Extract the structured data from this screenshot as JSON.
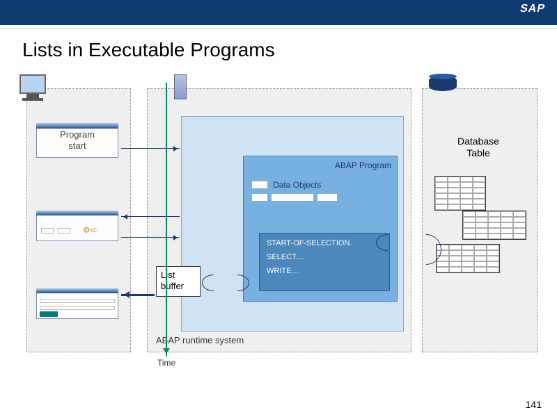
{
  "header": {
    "logo": "SAP"
  },
  "title": "Lists in Executable Programs",
  "left": {
    "program_start": "Program\nstart"
  },
  "center": {
    "runtime_label": "ABAP runtime system",
    "abap_program_label": "ABAP Program",
    "data_objects_label": "Data Objects",
    "code": {
      "line1": "START-OF-SELECTION.",
      "line2": "SELECT…",
      "line3": "WRITE…"
    },
    "list_buffer": "List\nbuffer"
  },
  "right": {
    "db_label": "Database\nTable"
  },
  "time_label": "Time",
  "page_number": "141"
}
